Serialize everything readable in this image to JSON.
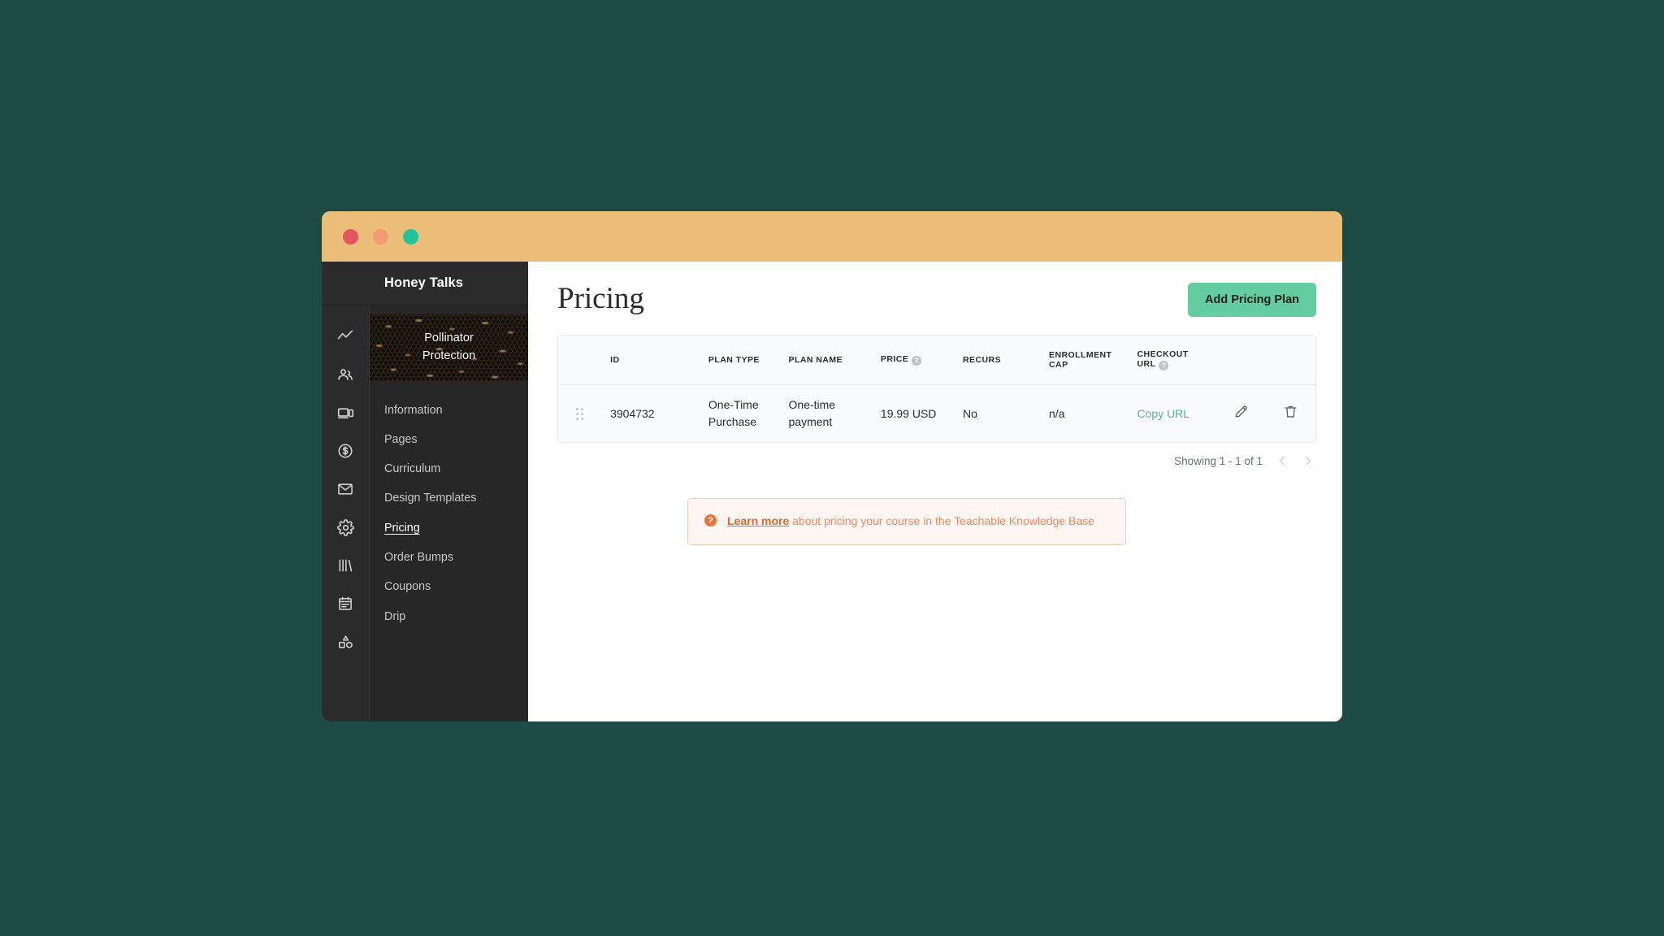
{
  "window": {
    "traffic_lights": [
      "close",
      "minimize",
      "maximize"
    ],
    "titlebar_color": "#eabd78",
    "desktop_background": "#1d4a42"
  },
  "sidebar": {
    "school_name": "Honey Talks",
    "rail_icons": [
      "analytics-icon",
      "users-icon",
      "devices-icon",
      "dollar-circle-icon",
      "mail-icon",
      "gear-icon",
      "library-icon",
      "notes-icon",
      "shapes-icon"
    ],
    "course": {
      "title_line1": "Pollinator",
      "title_line2": "Protection"
    },
    "nav_items": [
      {
        "label": "Information",
        "active": false
      },
      {
        "label": "Pages",
        "active": false
      },
      {
        "label": "Curriculum",
        "active": false
      },
      {
        "label": "Design Templates",
        "active": false
      },
      {
        "label": "Pricing",
        "active": true
      },
      {
        "label": "Order Bumps",
        "active": false
      },
      {
        "label": "Coupons",
        "active": false
      },
      {
        "label": "Drip",
        "active": false
      }
    ]
  },
  "main": {
    "page_title": "Pricing",
    "add_button_label": "Add Pricing Plan",
    "add_button_color": "#63cda0",
    "table": {
      "columns": [
        {
          "key": "handle",
          "label": ""
        },
        {
          "key": "id",
          "label": "ID"
        },
        {
          "key": "plan_type",
          "label": "PLAN TYPE"
        },
        {
          "key": "plan_name",
          "label": "PLAN NAME"
        },
        {
          "key": "price",
          "label": "PRICE",
          "help": "?"
        },
        {
          "key": "recurs",
          "label": "RECURS"
        },
        {
          "key": "enrollment_cap",
          "label": "ENROLLMENT CAP"
        },
        {
          "key": "checkout_url",
          "label": "CHECKOUT URL",
          "help": "?"
        },
        {
          "key": "edit",
          "label": ""
        },
        {
          "key": "delete",
          "label": ""
        }
      ],
      "header_enrollment_cap_line1": "ENROLLMENT",
      "header_enrollment_cap_line2": "CAP",
      "header_checkout_url_line1": "CHECKOUT",
      "header_checkout_url_line2": "URL",
      "rows": [
        {
          "id": "3904732",
          "plan_type": "One-Time Purchase",
          "plan_name": "One-time payment",
          "price": "19.99 USD",
          "recurs": "No",
          "enrollment_cap": "n/a",
          "checkout_url_label": "Copy URL",
          "checkout_url_color": "#57b39a",
          "edit_icon": "pencil-icon",
          "delete_icon": "trash-icon"
        }
      ]
    },
    "pagination": {
      "showing_text": "Showing 1 - 1 of 1",
      "prev_label": "‹",
      "next_label": "›"
    },
    "banner": {
      "icon": "?",
      "link_text": "Learn more",
      "text": " about pricing your course in the Teachable Knowledge Base",
      "accent_color": "#ec7239",
      "background": "#fdf6f2"
    }
  }
}
